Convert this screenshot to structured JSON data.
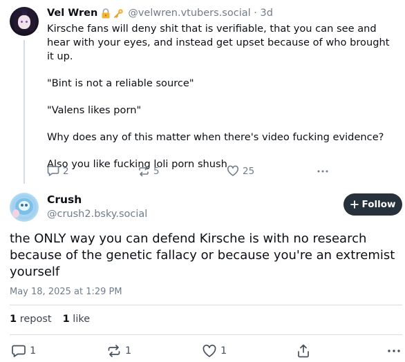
{
  "parent_post": {
    "author_name": "Vel Wren",
    "badges": [
      "lock-emoji-icon",
      "key-emoji-icon"
    ],
    "handle": "@velwren.vtubers.social",
    "separator": "·",
    "time": "3d",
    "paragraphs": [
      "Kirsche fans will deny shit that is verifiable, that you can see and hear with your eyes, and instead get upset because of who brought it up.",
      "\"Bint is not a reliable source\"",
      "\"Valens likes porn\"",
      "Why does any of this matter when there's video fucking evidence?",
      "Also you like fucking loli porn shush"
    ],
    "reply_count": "2",
    "repost_count": "5",
    "like_count": "25"
  },
  "main_post": {
    "author_name": "Crush",
    "handle": "@crush2.bsky.social",
    "follow_label": "Follow",
    "text": "the ONLY way you can defend Kirsche is with no research because of the genetic fallacy or because you're an extremist yourself",
    "date": "May 18, 2025 at 1:29 PM",
    "reposts_num": "1",
    "reposts_label": "repost",
    "likes_num": "1",
    "likes_label": "like",
    "reply_count": "1",
    "repost_count": "1",
    "like_count": "1"
  },
  "colors": {
    "accent_dark": "#27313c",
    "muted": "#6f7c8a",
    "divider": "#d7dee5"
  }
}
